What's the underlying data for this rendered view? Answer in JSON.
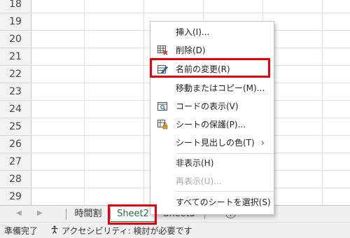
{
  "grid": {
    "row_numbers": [
      "18",
      "19",
      "20",
      "21",
      "22",
      "23",
      "24",
      "25",
      "26",
      "27",
      "28",
      "29",
      "18"
    ]
  },
  "tabs": {
    "items": [
      {
        "label": "時間割",
        "active": false
      },
      {
        "label": "Sheet2",
        "active": true
      },
      {
        "label": "Sheet3",
        "active": false
      }
    ],
    "add_label": "+"
  },
  "context_menu": {
    "items": [
      {
        "label": "挿入(I)...",
        "icon": "none",
        "enabled": true
      },
      {
        "label": "削除(D)",
        "icon": "delete-sheet-icon",
        "enabled": true
      },
      {
        "label": "名前の変更(R)",
        "icon": "rename-sheet-icon",
        "enabled": true,
        "highlighted": true
      },
      {
        "label": "移動またはコピー(M)...",
        "icon": "none",
        "enabled": true
      },
      {
        "label": "コードの表示(V)",
        "icon": "view-code-icon",
        "enabled": true
      },
      {
        "label": "シートの保護(P)...",
        "icon": "protect-sheet-icon",
        "enabled": true
      },
      {
        "label": "シート見出しの色(T)",
        "icon": "none",
        "enabled": true,
        "submenu": true
      },
      {
        "label": "非表示(H)",
        "icon": "none",
        "enabled": true
      },
      {
        "label": "再表示(U)...",
        "icon": "none",
        "enabled": false
      },
      {
        "label": "すべてのシートを選択(S)",
        "icon": "none",
        "enabled": true
      }
    ],
    "submenu_arrow": "›"
  },
  "status": {
    "ready": "準備完了",
    "accessibility": "アクセシビリティ: 検討が必要です"
  },
  "colors": {
    "highlight": "#e8000b",
    "active_tab": "#217346"
  }
}
